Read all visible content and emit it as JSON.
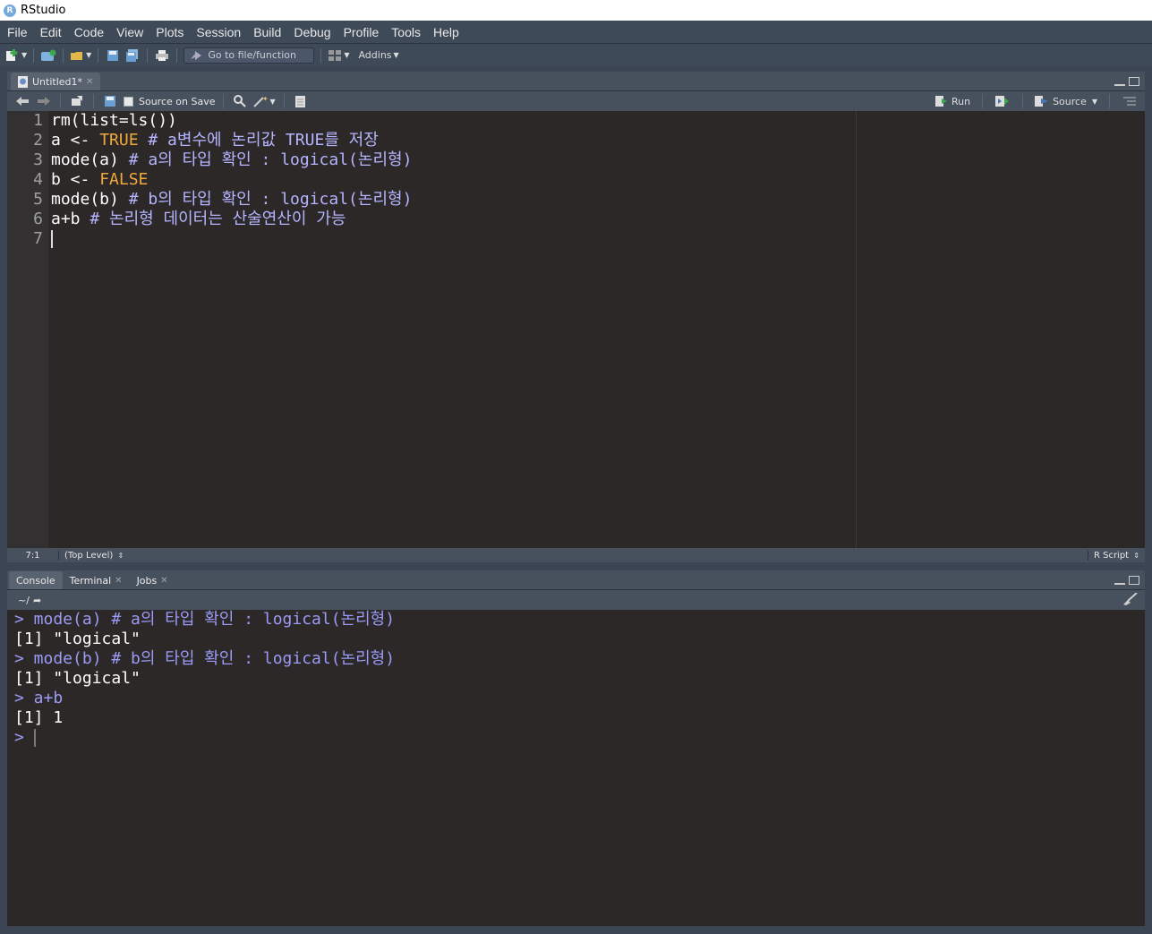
{
  "window": {
    "title": "RStudio",
    "icon_letter": "R"
  },
  "menu": [
    "File",
    "Edit",
    "Code",
    "View",
    "Plots",
    "Session",
    "Build",
    "Debug",
    "Profile",
    "Tools",
    "Help"
  ],
  "toolbar": {
    "goto_placeholder": "Go to file/function",
    "addins_label": "Addins"
  },
  "source_pane": {
    "tab_label": "Untitled1*",
    "source_on_save_label": "Source on Save",
    "run_label": "Run",
    "source_label": "Source",
    "lines": [
      {
        "n": "1",
        "parts": [
          {
            "t": "rm(list=ls())",
            "c": "plain"
          }
        ]
      },
      {
        "n": "2",
        "parts": [
          {
            "t": "a <- ",
            "c": "plain"
          },
          {
            "t": "TRUE",
            "c": "kw"
          },
          {
            "t": " # a변수에 논리값 TRUE를 저장",
            "c": "cm"
          }
        ]
      },
      {
        "n": "3",
        "parts": [
          {
            "t": "mode(a) ",
            "c": "plain"
          },
          {
            "t": "# a의 타입 확인 : logical(논리형)",
            "c": "cm"
          }
        ]
      },
      {
        "n": "4",
        "parts": [
          {
            "t": "b <- ",
            "c": "plain"
          },
          {
            "t": "FALSE",
            "c": "kw"
          }
        ]
      },
      {
        "n": "5",
        "parts": [
          {
            "t": "mode(b) ",
            "c": "plain"
          },
          {
            "t": "# b의 타입 확인 : logical(논리형)",
            "c": "cm"
          }
        ]
      },
      {
        "n": "6",
        "parts": [
          {
            "t": "a+b ",
            "c": "plain"
          },
          {
            "t": "# 논리형 데이터는 산술연산이 가능",
            "c": "cm"
          }
        ]
      },
      {
        "n": "7",
        "parts": []
      }
    ],
    "status_position": "7:1",
    "status_level": "(Top Level)",
    "status_filetype": "R Script"
  },
  "console_pane": {
    "tabs": [
      "Console",
      "Terminal",
      "Jobs"
    ],
    "path": "~/",
    "lines": [
      {
        "t": "> mode(a) # a의 타입 확인 : logical(논리형)",
        "c": "cin"
      },
      {
        "t": "[1] \"logical\"",
        "c": "cout"
      },
      {
        "t": "> mode(b) # b의 타입 확인 : logical(논리형)",
        "c": "cin"
      },
      {
        "t": "[1] \"logical\"",
        "c": "cout"
      },
      {
        "t": "> a+b",
        "c": "cin"
      },
      {
        "t": "[1] 1",
        "c": "cout"
      },
      {
        "t": "> ",
        "c": "cin"
      }
    ]
  }
}
